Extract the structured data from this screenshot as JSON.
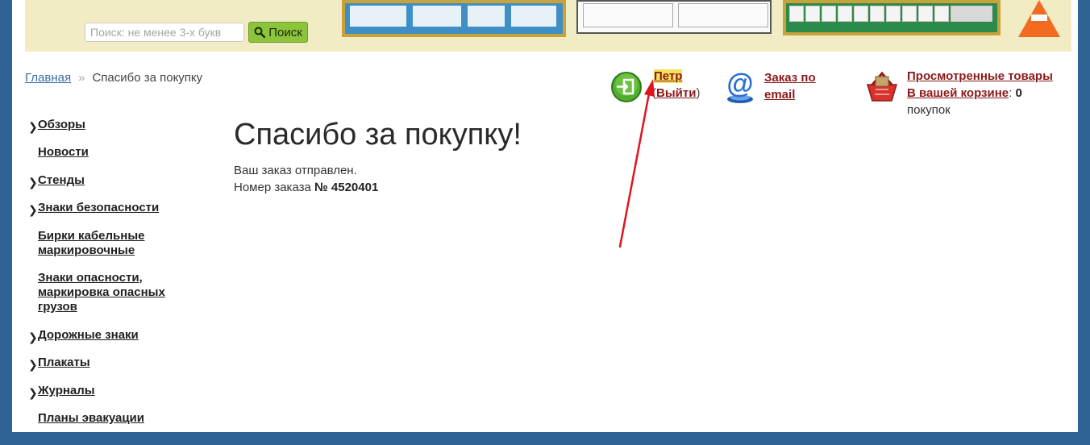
{
  "search": {
    "placeholder": "Поиск: не менее 3-х букв",
    "button_label": "Поиск"
  },
  "breadcrumb": {
    "home": "Главная",
    "separator": "»",
    "current": "Спасибо за покупку"
  },
  "user": {
    "name": "Петр",
    "logout_open": "(",
    "logout_label": "Выйти",
    "logout_close": ")"
  },
  "email_order": {
    "label": "Заказ по email"
  },
  "cart": {
    "viewed_label": "Просмотренные товары",
    "in_cart_label": "В вашей корзине",
    "colon": ": ",
    "count": "0",
    "unit": "покупок"
  },
  "sidebar": {
    "items": [
      {
        "label": "Обзоры",
        "has_children": true
      },
      {
        "label": "Новости",
        "has_children": false
      },
      {
        "label": "Стенды",
        "has_children": true
      },
      {
        "label": "Знаки безопасности",
        "has_children": true
      },
      {
        "label": "Бирки кабельные маркировочные",
        "has_children": false
      },
      {
        "label": "Знаки опасности, маркировка опасных грузов",
        "has_children": false
      },
      {
        "label": "Дорожные знаки",
        "has_children": true
      },
      {
        "label": "Плакаты",
        "has_children": true
      },
      {
        "label": "Журналы",
        "has_children": true
      },
      {
        "label": "Планы эвакуации",
        "has_children": false
      }
    ]
  },
  "main": {
    "title": "Спасибо за покупку!",
    "status": "Ваш заказ отправлен.",
    "order_number_label": "Номер заказа ",
    "order_number": "№ 4520401"
  },
  "colors": {
    "page_frame": "#2f6395",
    "banner": "#f2ecc4",
    "link_dark_red": "#8b1a1a",
    "search_button": "#8cc43c",
    "highlight": "#f5e15c",
    "annotation_arrow": "#e0141e"
  }
}
